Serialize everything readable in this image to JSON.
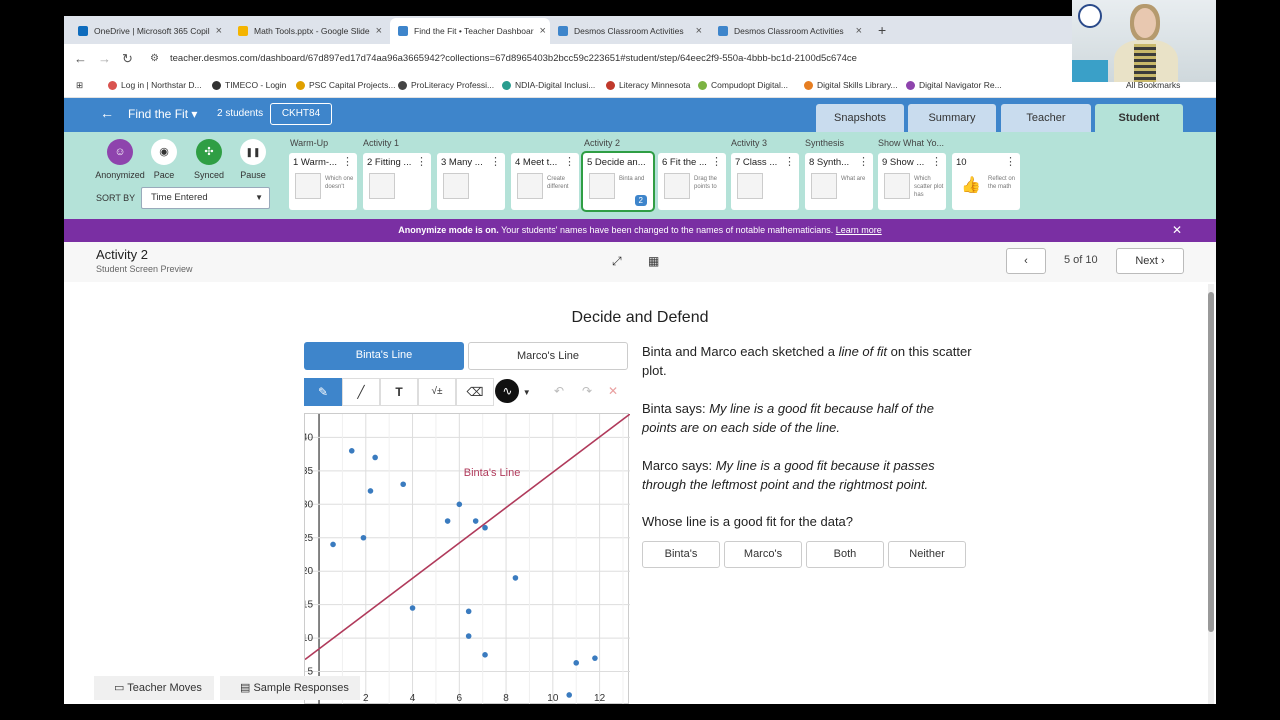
{
  "browser": {
    "tabs": [
      {
        "label": "OneDrive | Microsoft 365 Copil",
        "color": "#0f6cbd"
      },
      {
        "label": "Math Tools.pptx - Google Slide",
        "color": "#f4b400"
      },
      {
        "label": "Find the Fit • Teacher Dashboar",
        "color": "#3e85cb",
        "active": true
      },
      {
        "label": "Desmos Classroom Activities",
        "color": "#3e85cb"
      },
      {
        "label": "Desmos Classroom Activities",
        "color": "#3e85cb"
      }
    ],
    "url": "teacher.desmos.com/dashboard/67d897ed17d74aa96a3665942?collections=67d8965403b2bcc59c223651#student/step/64eec2f9-550a-4bbb-bc1d-2100d5c674ce",
    "bookmarks": [
      "Log in | Northstar D...",
      "TIMECO - Login",
      "PSC Capital Projects...",
      "ProLiteracy Professi...",
      "NDIA-Digital Inclusi...",
      "Literacy Minnesota",
      "Compudopt Digital...",
      "Digital Skills Library...",
      "Digital Navigator Re..."
    ],
    "all_bookmarks": "All Bookmarks"
  },
  "header": {
    "activity_title": "Find the Fit",
    "students": "2 students",
    "class_code": "CKHT84",
    "view_tabs": [
      "Snapshots",
      "Summary",
      "Teacher",
      "Student"
    ],
    "active_view": "Student"
  },
  "controls": [
    {
      "label": "Anonymized",
      "color": "#8e44ad",
      "glyph": "☺"
    },
    {
      "label": "Pace",
      "color": "#ffffff",
      "glyph": "◉"
    },
    {
      "label": "Synced",
      "color": "#2f9e44",
      "glyph": "✣"
    },
    {
      "label": "Pause",
      "color": "#ffffff",
      "glyph": "❚❚"
    }
  ],
  "sort": {
    "label": "SORT BY",
    "value": "Time Entered"
  },
  "groups": [
    "Warm-Up",
    "Activity 1",
    "Activity 2",
    "Activity 3",
    "Synthesis",
    "Show What Yo..."
  ],
  "cards": [
    {
      "title": "1 Warm-...",
      "sub": "Which one doesn't"
    },
    {
      "title": "2 Fitting ...",
      "sub": ""
    },
    {
      "title": "3 Many ...",
      "sub": ""
    },
    {
      "title": "4 Meet t...",
      "sub": "Create different"
    },
    {
      "title": "5 Decide an...",
      "sub": "Binta and",
      "badge": "2"
    },
    {
      "title": "6 Fit the ...",
      "sub": "Drag the points to"
    },
    {
      "title": "7 Class ...",
      "sub": ""
    },
    {
      "title": "8 Synth...",
      "sub": "What are"
    },
    {
      "title": "9 Show ...",
      "sub": "Which scatter plot has"
    },
    {
      "title": "10",
      "sub": "Reflect on the math"
    }
  ],
  "banner": {
    "bold": "Anonymize mode is on.",
    "text": " Your students' names have been changed to the names of notable mathematicians. ",
    "link": "Learn more"
  },
  "activity_bar": {
    "title": "Activity 2",
    "subtitle": "Student Screen Preview",
    "page": "5 of 10",
    "next": "Next"
  },
  "screen": {
    "title": "Decide and Defend",
    "line_tabs": [
      "Binta's Line",
      "Marco's Line"
    ],
    "graph_label": "Binta's Line",
    "prompt_1a": "Binta and Marco each sketched a ",
    "prompt_1b": "line of fit",
    "prompt_1c": " on this scatter plot.",
    "prompt_2a": "Binta says: ",
    "prompt_2b": "My line is a good fit because half of the points are on each side of the line.",
    "prompt_3a": "Marco says: ",
    "prompt_3b": "My line is a good fit because it passes through the leftmost point and the rightmost point.",
    "question": "Whose line is a good fit for the data?",
    "choices": [
      "Binta's",
      "Marco's",
      "Both",
      "Neither"
    ]
  },
  "footer": {
    "teacher_moves": "Teacher Moves",
    "sample_responses": "Sample Responses"
  },
  "chart_data": {
    "type": "scatter",
    "x_ticks": [
      2,
      4,
      6,
      8,
      10,
      12
    ],
    "y_ticks": [
      5,
      10,
      15,
      20,
      25,
      30,
      35,
      40
    ],
    "xlim": [
      -0.6,
      13.3
    ],
    "ylim": [
      0,
      43.5
    ],
    "points": [
      [
        0.6,
        24
      ],
      [
        1.4,
        38
      ],
      [
        1.9,
        25
      ],
      [
        2.2,
        32
      ],
      [
        2.4,
        37
      ],
      [
        3.6,
        33
      ],
      [
        4.0,
        14.5
      ],
      [
        5.5,
        27.5
      ],
      [
        6.0,
        30
      ],
      [
        6.4,
        14
      ],
      [
        6.4,
        10.3
      ],
      [
        6.7,
        27.5
      ],
      [
        7.1,
        26.5
      ],
      [
        7.1,
        7.5
      ],
      [
        8.4,
        19
      ],
      [
        10.7,
        1.5
      ],
      [
        11.0,
        6.3
      ],
      [
        11.8,
        7
      ]
    ],
    "series": [
      {
        "name": "Binta's Line",
        "x": [
          -0.6,
          13.3
        ],
        "y": [
          6.8,
          43.5
        ]
      }
    ],
    "grid": true,
    "point_color": "#3a7bbf",
    "line_color": "#b03a5b"
  }
}
